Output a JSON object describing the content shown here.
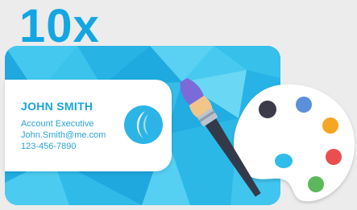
{
  "banner": {
    "multiplier": "10x"
  },
  "business_card": {
    "name": "JOHN SMITH",
    "title": "Account Executive",
    "email": "John.Smith@me.com",
    "phone": "123-456-7890"
  },
  "icons": {
    "logo": "circle-logo-icon",
    "palette": "paint-palette-icon",
    "brush": "paintbrush-icon"
  },
  "colors": {
    "accent": "#13a6e3",
    "card_blue": "#2fbde9",
    "palette_black": "#3b3b4a",
    "palette_blue": "#5b8fd9",
    "palette_orange": "#f5a623",
    "palette_red": "#ea4f4f",
    "palette_green": "#5cb85c"
  }
}
